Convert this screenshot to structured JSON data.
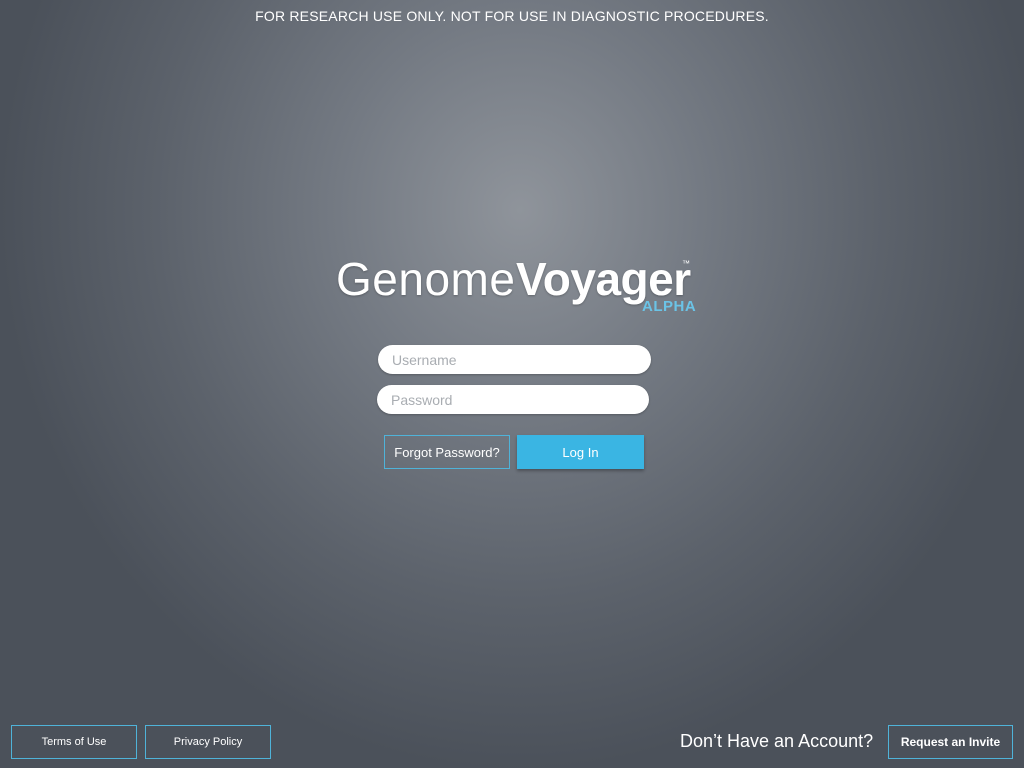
{
  "disclaimer": "FOR RESEARCH USE ONLY. NOT FOR USE IN DIAGNOSTIC PROCEDURES.",
  "logo": {
    "word1": "Genome",
    "word2": "Voyager",
    "trademark": "™",
    "tag": "ALPHA"
  },
  "login": {
    "username_placeholder": "Username",
    "username_value": "",
    "password_placeholder": "Password",
    "password_value": "",
    "forgot_label": "Forgot Password?",
    "login_label": "Log In"
  },
  "footer": {
    "terms_label": "Terms of Use",
    "privacy_label": "Privacy Policy",
    "no_account_text": "Don’t Have an Account?",
    "request_label": "Request an Invite"
  },
  "colors": {
    "accent": "#3ab5e3",
    "alpha_tag": "#6bc3e6",
    "button_border": "#4fb3d9",
    "background": "#5c626b"
  }
}
